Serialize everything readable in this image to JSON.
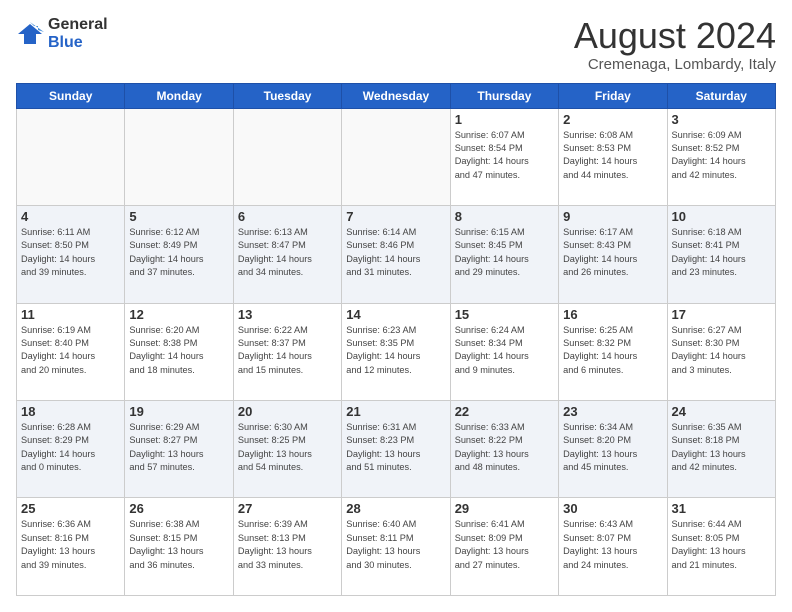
{
  "header": {
    "logo_line1": "General",
    "logo_line2": "Blue",
    "month": "August 2024",
    "location": "Cremenaga, Lombardy, Italy"
  },
  "days_of_week": [
    "Sunday",
    "Monday",
    "Tuesday",
    "Wednesday",
    "Thursday",
    "Friday",
    "Saturday"
  ],
  "weeks": [
    [
      {
        "day": "",
        "info": ""
      },
      {
        "day": "",
        "info": ""
      },
      {
        "day": "",
        "info": ""
      },
      {
        "day": "",
        "info": ""
      },
      {
        "day": "1",
        "info": "Sunrise: 6:07 AM\nSunset: 8:54 PM\nDaylight: 14 hours\nand 47 minutes."
      },
      {
        "day": "2",
        "info": "Sunrise: 6:08 AM\nSunset: 8:53 PM\nDaylight: 14 hours\nand 44 minutes."
      },
      {
        "day": "3",
        "info": "Sunrise: 6:09 AM\nSunset: 8:52 PM\nDaylight: 14 hours\nand 42 minutes."
      }
    ],
    [
      {
        "day": "4",
        "info": "Sunrise: 6:11 AM\nSunset: 8:50 PM\nDaylight: 14 hours\nand 39 minutes."
      },
      {
        "day": "5",
        "info": "Sunrise: 6:12 AM\nSunset: 8:49 PM\nDaylight: 14 hours\nand 37 minutes."
      },
      {
        "day": "6",
        "info": "Sunrise: 6:13 AM\nSunset: 8:47 PM\nDaylight: 14 hours\nand 34 minutes."
      },
      {
        "day": "7",
        "info": "Sunrise: 6:14 AM\nSunset: 8:46 PM\nDaylight: 14 hours\nand 31 minutes."
      },
      {
        "day": "8",
        "info": "Sunrise: 6:15 AM\nSunset: 8:45 PM\nDaylight: 14 hours\nand 29 minutes."
      },
      {
        "day": "9",
        "info": "Sunrise: 6:17 AM\nSunset: 8:43 PM\nDaylight: 14 hours\nand 26 minutes."
      },
      {
        "day": "10",
        "info": "Sunrise: 6:18 AM\nSunset: 8:41 PM\nDaylight: 14 hours\nand 23 minutes."
      }
    ],
    [
      {
        "day": "11",
        "info": "Sunrise: 6:19 AM\nSunset: 8:40 PM\nDaylight: 14 hours\nand 20 minutes."
      },
      {
        "day": "12",
        "info": "Sunrise: 6:20 AM\nSunset: 8:38 PM\nDaylight: 14 hours\nand 18 minutes."
      },
      {
        "day": "13",
        "info": "Sunrise: 6:22 AM\nSunset: 8:37 PM\nDaylight: 14 hours\nand 15 minutes."
      },
      {
        "day": "14",
        "info": "Sunrise: 6:23 AM\nSunset: 8:35 PM\nDaylight: 14 hours\nand 12 minutes."
      },
      {
        "day": "15",
        "info": "Sunrise: 6:24 AM\nSunset: 8:34 PM\nDaylight: 14 hours\nand 9 minutes."
      },
      {
        "day": "16",
        "info": "Sunrise: 6:25 AM\nSunset: 8:32 PM\nDaylight: 14 hours\nand 6 minutes."
      },
      {
        "day": "17",
        "info": "Sunrise: 6:27 AM\nSunset: 8:30 PM\nDaylight: 14 hours\nand 3 minutes."
      }
    ],
    [
      {
        "day": "18",
        "info": "Sunrise: 6:28 AM\nSunset: 8:29 PM\nDaylight: 14 hours\nand 0 minutes."
      },
      {
        "day": "19",
        "info": "Sunrise: 6:29 AM\nSunset: 8:27 PM\nDaylight: 13 hours\nand 57 minutes."
      },
      {
        "day": "20",
        "info": "Sunrise: 6:30 AM\nSunset: 8:25 PM\nDaylight: 13 hours\nand 54 minutes."
      },
      {
        "day": "21",
        "info": "Sunrise: 6:31 AM\nSunset: 8:23 PM\nDaylight: 13 hours\nand 51 minutes."
      },
      {
        "day": "22",
        "info": "Sunrise: 6:33 AM\nSunset: 8:22 PM\nDaylight: 13 hours\nand 48 minutes."
      },
      {
        "day": "23",
        "info": "Sunrise: 6:34 AM\nSunset: 8:20 PM\nDaylight: 13 hours\nand 45 minutes."
      },
      {
        "day": "24",
        "info": "Sunrise: 6:35 AM\nSunset: 8:18 PM\nDaylight: 13 hours\nand 42 minutes."
      }
    ],
    [
      {
        "day": "25",
        "info": "Sunrise: 6:36 AM\nSunset: 8:16 PM\nDaylight: 13 hours\nand 39 minutes."
      },
      {
        "day": "26",
        "info": "Sunrise: 6:38 AM\nSunset: 8:15 PM\nDaylight: 13 hours\nand 36 minutes."
      },
      {
        "day": "27",
        "info": "Sunrise: 6:39 AM\nSunset: 8:13 PM\nDaylight: 13 hours\nand 33 minutes."
      },
      {
        "day": "28",
        "info": "Sunrise: 6:40 AM\nSunset: 8:11 PM\nDaylight: 13 hours\nand 30 minutes."
      },
      {
        "day": "29",
        "info": "Sunrise: 6:41 AM\nSunset: 8:09 PM\nDaylight: 13 hours\nand 27 minutes."
      },
      {
        "day": "30",
        "info": "Sunrise: 6:43 AM\nSunset: 8:07 PM\nDaylight: 13 hours\nand 24 minutes."
      },
      {
        "day": "31",
        "info": "Sunrise: 6:44 AM\nSunset: 8:05 PM\nDaylight: 13 hours\nand 21 minutes."
      }
    ]
  ]
}
